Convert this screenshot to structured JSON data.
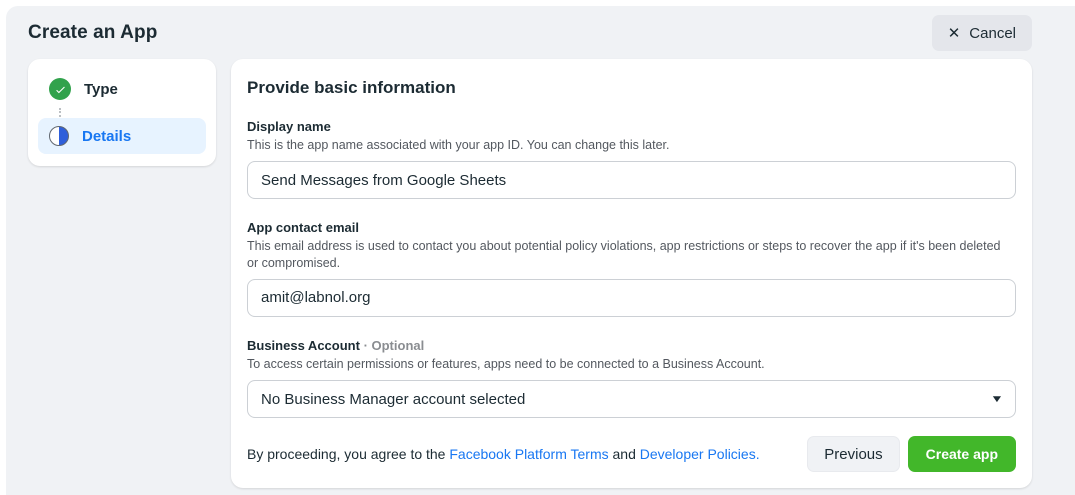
{
  "header": {
    "title": "Create an App",
    "cancel_label": "Cancel",
    "cancel_icon": "✕"
  },
  "stepper": {
    "steps": [
      {
        "label": "Type",
        "state": "complete"
      },
      {
        "label": "Details",
        "state": "current"
      }
    ]
  },
  "main": {
    "heading": "Provide basic information",
    "fields": {
      "display_name": {
        "label": "Display name",
        "description": "This is the app name associated with your app ID. You can change this later.",
        "value": "Send Messages from Google Sheets"
      },
      "contact_email": {
        "label": "App contact email",
        "description": "This email address is used to contact you about potential policy violations, app restrictions or steps to recover the app if it's been deleted or compromised.",
        "value": "amit@labnol.org"
      },
      "business_account": {
        "label": "Business Account",
        "optional_tag": "· Optional",
        "description": "To access certain permissions or features, apps need to be connected to a Business Account.",
        "selected_value": "No Business Manager account selected",
        "caret_icon": "▼"
      }
    },
    "footer": {
      "agreement_prefix": "By proceeding, you agree to the ",
      "terms_link": "Facebook Platform Terms",
      "agreement_middle": " and ",
      "policies_link": "Developer Policies.",
      "previous_label": "Previous",
      "create_label": "Create app"
    }
  },
  "colors": {
    "background": "#f0f2f5",
    "accent_blue": "#1877f2",
    "success_green": "#31a24c",
    "primary_button_green": "#42b72a",
    "step_highlight": "#e7f3ff"
  }
}
